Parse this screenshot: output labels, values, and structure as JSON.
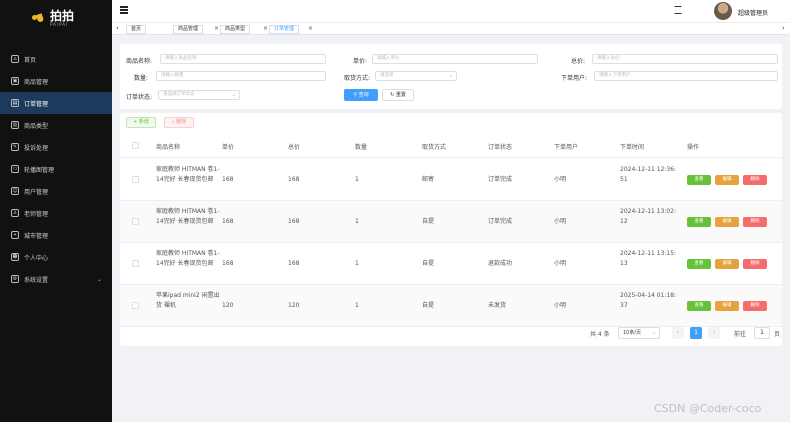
{
  "app": {
    "logo_title": "拍拍",
    "logo_sub": "PAIPAI"
  },
  "sidebar": {
    "items": [
      {
        "label": "首页",
        "icon": "home-icon"
      },
      {
        "label": "商品管理",
        "icon": "goods-icon"
      },
      {
        "label": "订单管理",
        "icon": "order-icon",
        "active": true
      },
      {
        "label": "商品类型",
        "icon": "category-icon"
      },
      {
        "label": "投诉处理",
        "icon": "complaint-icon"
      },
      {
        "label": "轮播图管理",
        "icon": "carousel-icon"
      },
      {
        "label": "用户管理",
        "icon": "user-icon"
      },
      {
        "label": "老师管理",
        "icon": "teacher-icon"
      },
      {
        "label": "城市管理",
        "icon": "city-icon"
      },
      {
        "label": "个人中心",
        "icon": "profile-icon"
      },
      {
        "label": "系统设置",
        "icon": "settings-icon"
      }
    ]
  },
  "header": {
    "user_name": "超级管理员"
  },
  "tabs": [
    {
      "label": "首页"
    },
    {
      "label": "商品管理"
    },
    {
      "label": "商品类型"
    },
    {
      "label": "订单管理"
    }
  ],
  "search": {
    "name_label": "商品名称:",
    "name_placeholder": "请输入商品名称",
    "price_label": "单价:",
    "price_placeholder": "请输入单价",
    "total_label": "总价:",
    "total_placeholder": "请输入总价",
    "qty_label": "数量:",
    "qty_placeholder": "请输入数量",
    "method_label": "取货方式:",
    "method_placeholder": "请选择",
    "user_label": "下单用户:",
    "user_placeholder": "请输入下单用户",
    "status_label": "订单状态:",
    "status_placeholder": "请选择订单状态",
    "query_button": "查询",
    "reset_button": "重置"
  },
  "toolbar": {
    "add_button": "新增",
    "delete_button": "删除"
  },
  "table": {
    "headers": [
      "商品名称",
      "单价",
      "总价",
      "数量",
      "取货方式",
      "订单状态",
      "下单用户",
      "下单时间",
      "操作"
    ],
    "rows": [
      {
        "name": "家庭教师 HITMAN 卷1-14完好 长春现货包邮",
        "price": "168",
        "total": "168",
        "qty": "1",
        "method": "邮寄",
        "status": "订单完成",
        "user": "小明",
        "time": "2024-12-11 12:36:51"
      },
      {
        "name": "家庭教师 HITMAN 卷1-14完好 长春现货包邮",
        "price": "168",
        "total": "168",
        "qty": "1",
        "method": "自提",
        "status": "订单完成",
        "user": "小明",
        "time": "2024-12-11 13:02:12"
      },
      {
        "name": "家庭教师 HITMAN 卷1-14完好 长春现货包邮",
        "price": "168",
        "total": "168",
        "qty": "1",
        "method": "自提",
        "status": "退款成功",
        "user": "小明",
        "time": "2024-12-11 13:15:13"
      },
      {
        "name": "苹果ipad mini2 闲置出货 裸机",
        "price": "120",
        "total": "120",
        "qty": "1",
        "method": "自提",
        "status": "未发货",
        "user": "小明",
        "time": "2025-04-14 01:18:37"
      }
    ],
    "actions": {
      "view": "查看",
      "edit": "编辑",
      "delete": "删除"
    }
  },
  "pagination": {
    "total": "共 4 条",
    "page_size": "10条/页",
    "current_page": "1",
    "goto_label": "前往",
    "goto_value": "1",
    "goto_unit": "页"
  },
  "watermark": "CSDN @Coder-coco"
}
